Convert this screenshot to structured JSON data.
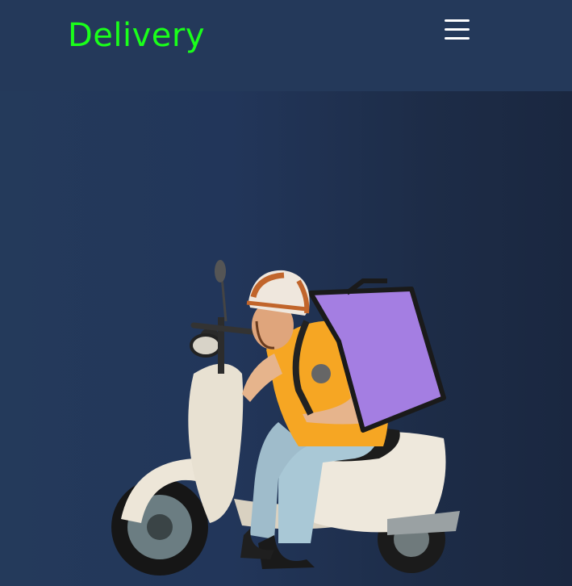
{
  "header": {
    "brand": "Delivery",
    "menu_icon": "hamburger-menu-icon"
  },
  "hero": {
    "image": "delivery-rider-on-scooter-illustration"
  },
  "colors": {
    "brand_text": "#1aff1a",
    "navbar_bg": "#24395a",
    "hero_bg": "#1d2c47",
    "scooter_body": "#ede6d8",
    "shirt": "#f6a623",
    "delivery_bag": "#a47ee2"
  }
}
